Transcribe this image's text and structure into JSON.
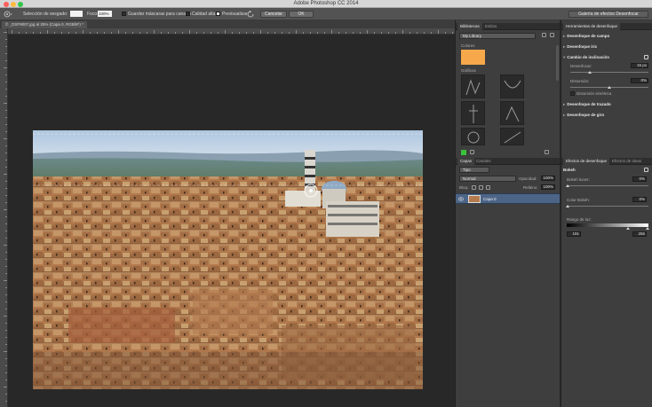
{
  "window": {
    "title": "Adobe Photoshop CC 2014"
  },
  "options_bar": {
    "selection_label": "Selección de sesgado:",
    "focus_label": "Foco:",
    "focus_value": "100%",
    "save_masks_label": "Guardar máscaras para canales",
    "high_quality_label": "Calidad alta",
    "preview_label": "Previsualizar",
    "cancel_label": "Cancelar",
    "ok_label": "OK",
    "gallery_select": "Galería de efectos Desenfocar"
  },
  "document": {
    "tab_label": "© _DSF9007.jpg al 25% (Capa 0, RGB/8*) *"
  },
  "libraries_panel": {
    "tabs": [
      "Bibliotecas",
      "Estilos"
    ],
    "library_select": "My Library",
    "colors_label": "Colores",
    "graphics_label": "Gráficos",
    "swatch_color": "#f6a84a",
    "accent_green": "#3ac23a"
  },
  "layers_panel": {
    "tabs": [
      "Capas",
      "Canales"
    ],
    "kind_label": "Tipo",
    "blend_mode": "Normal",
    "opacity_label": "Opacidad:",
    "opacity_value": "100%",
    "lock_label": "Bloq.:",
    "fill_label": "Relleno:",
    "fill_value": "100%",
    "layer_name": "Capa 0",
    "selected_color": "#4c6587"
  },
  "blur_tools_panel": {
    "title": "Herramientas de desenfoque",
    "sections": [
      "Desenfoque de campo",
      "Desenfoque iris",
      "Cambio de inclinación",
      "Desenfoque de trazado",
      "Desenfoque de giro"
    ],
    "blur_label": "Desenfocar:",
    "blur_value": "15 px",
    "distortion_label": "Distorsión:",
    "distortion_value": "0%",
    "symmetric_label": "Distorsión simétrica"
  },
  "blur_effects_panel": {
    "tabs": [
      "Efectos de desenfoque",
      "Efectos de ideas"
    ],
    "bokeh_label": "Bokeh",
    "light_bokeh_label": "Bokeh luces:",
    "light_bokeh_value": "0%",
    "color_bokeh_label": "Color Bokeh:",
    "color_bokeh_value": "0%",
    "light_range_label": "Rango de luz:",
    "range_low": "191",
    "range_high": "255"
  }
}
